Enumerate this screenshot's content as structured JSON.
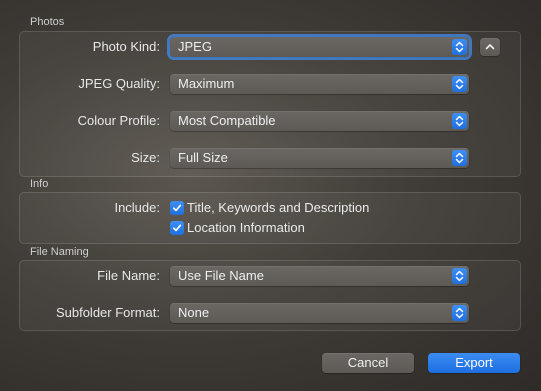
{
  "sections": {
    "photos_title": "Photos",
    "info_title": "Info",
    "file_naming_title": "File Naming"
  },
  "photos": {
    "photo_kind": {
      "label": "Photo Kind:",
      "value": "JPEG"
    },
    "jpeg_quality": {
      "label": "JPEG Quality:",
      "value": "Maximum"
    },
    "colour_profile": {
      "label": "Colour Profile:",
      "value": "Most Compatible"
    },
    "size": {
      "label": "Size:",
      "value": "Full Size"
    }
  },
  "info": {
    "include_label": "Include:",
    "options": [
      {
        "label": "Title, Keywords and Description",
        "checked": true
      },
      {
        "label": "Location Information",
        "checked": true
      }
    ]
  },
  "file_naming": {
    "file_name": {
      "label": "File Name:",
      "value": "Use File Name"
    },
    "subfolder_format": {
      "label": "Subfolder Format:",
      "value": "None"
    }
  },
  "buttons": {
    "cancel": "Cancel",
    "export": "Export"
  },
  "icons": {
    "popup_arrows": "up-down-chevron-icon",
    "disclosure": "chevron-up-icon",
    "checkmark": "checkmark-icon"
  },
  "colors": {
    "accent": "#2a7ef0",
    "control_bg": "#66635f"
  }
}
